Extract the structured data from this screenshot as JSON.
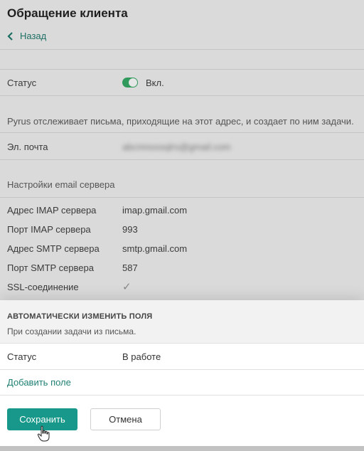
{
  "header": {
    "title": "Обращение клиента",
    "back_label": "Назад"
  },
  "status_row": {
    "label": "Статус",
    "toggle_on": true,
    "toggle_text": "Вкл."
  },
  "info_text": "Pyrus отслеживает письма, приходящие на этот адрес, и создает по ним задачи.",
  "email_row": {
    "label": "Эл. почта",
    "value": "abcmnoxsqlrs@gmail.com"
  },
  "server_section": {
    "heading": "Настройки email сервера",
    "rows": [
      {
        "label": "Адрес IMAP сервера",
        "value": "imap.gmail.com"
      },
      {
        "label": "Порт IMAP сервера",
        "value": "993"
      },
      {
        "label": "Адрес SMTP сервера",
        "value": "smtp.gmail.com"
      },
      {
        "label": "Порт SMTP сервера",
        "value": "587"
      }
    ],
    "ssl_label": "SSL-соединение",
    "ssl_checked": true,
    "ssl_glyph": "✓"
  },
  "panel": {
    "heading": "АВТОМАТИЧЕСКИ ИЗМЕНИТЬ ПОЛЯ",
    "subtitle": "При создании задачи из письма.",
    "field_label": "Статус",
    "field_value": "В работе",
    "add_field_label": "Добавить поле",
    "save_label": "Сохранить",
    "cancel_label": "Отмена"
  },
  "colors": {
    "accent": "#18988a",
    "toggle_on": "#2f9a5b",
    "link": "#1f7f73"
  }
}
